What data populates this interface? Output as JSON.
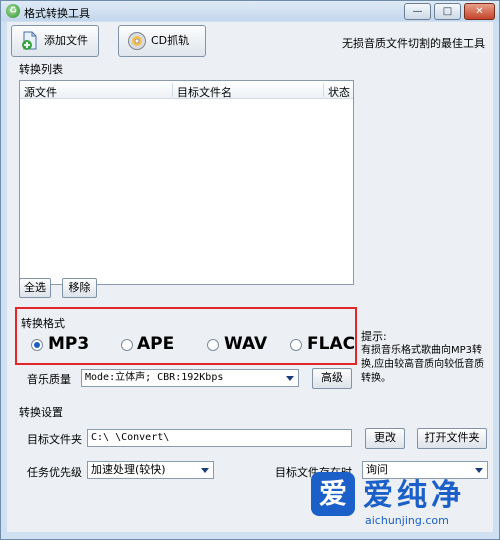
{
  "window": {
    "title": "格式转换工具",
    "icon": "app-logo-icon",
    "minimize": "—",
    "maximize": "□",
    "close": "✕"
  },
  "toolbar": {
    "add_file": "添加文件",
    "cd_rip": "CD抓轨",
    "slogan": "无损音质文件切割的最佳工具"
  },
  "list": {
    "group_label": "转换列表",
    "columns": [
      "源文件",
      "目标文件名",
      "状态"
    ],
    "rows": []
  },
  "list_buttons": {
    "select_all": "全选",
    "remove": "移除"
  },
  "format": {
    "title": "转换格式",
    "options": [
      {
        "label": "MP3",
        "checked": true
      },
      {
        "label": "APE",
        "checked": false
      },
      {
        "label": "WAV",
        "checked": false
      },
      {
        "label": "FLAC",
        "checked": false
      }
    ],
    "highlight_color": "#e02828"
  },
  "quality": {
    "label": "音乐质量",
    "value": "Mode:立体声; CBR:192Kbps",
    "advanced": "高级"
  },
  "hint": {
    "title": "提示:",
    "text": "有损音乐格式歌曲向MP3转换,应由较高音质向较低音质转换。"
  },
  "settings": {
    "group_label": "转换设置",
    "target_folder_label": "目标文件夹",
    "target_folder_value": "C:\\        \\Convert\\",
    "change": "更改",
    "open_folder": "打开文件夹",
    "priority_label": "任务优先级",
    "priority_value": "加速处理(较快)",
    "exists_label": "目标文件存在时",
    "exists_value": "询问"
  },
  "watermark": {
    "brand": "爱纯净",
    "url": "aichunjing.com",
    "logo": "爱",
    "color": "#1b5fc8"
  }
}
